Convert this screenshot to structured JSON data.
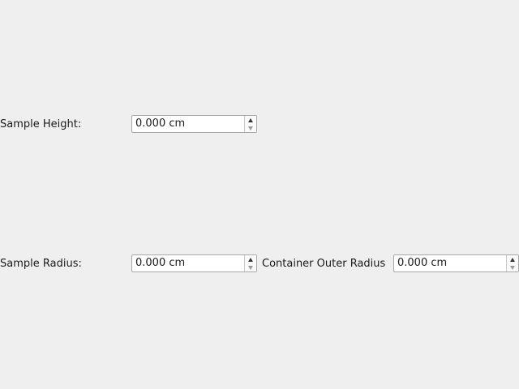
{
  "fields": {
    "sample_height": {
      "label": "Sample Height:",
      "value": "0.000 cm"
    },
    "sample_radius": {
      "label": "Sample Radius:",
      "value": "0.000 cm"
    },
    "container_outer_radius": {
      "label": "Container Outer Radius",
      "value": "0.000 cm"
    }
  },
  "icons": {
    "increment": "spin-up-icon",
    "decrement": "spin-down-icon"
  },
  "colors": {
    "background": "#efefef",
    "field_border": "#a9a9a9"
  }
}
